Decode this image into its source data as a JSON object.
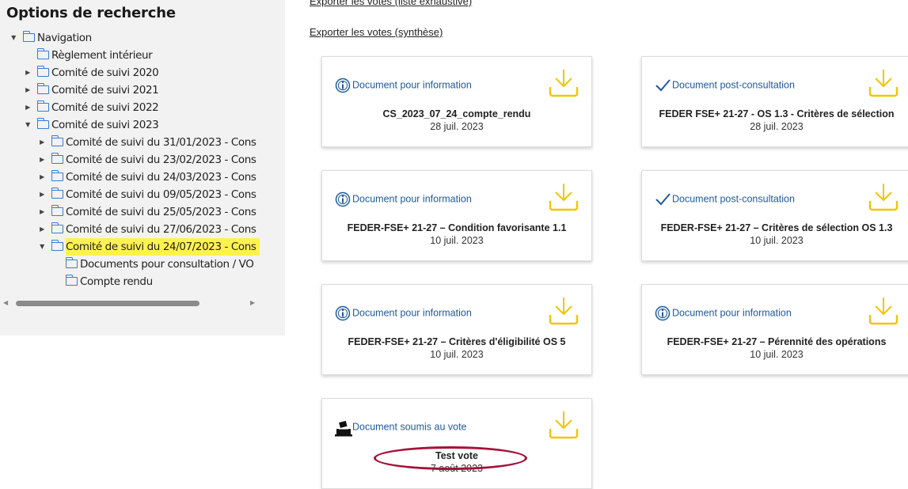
{
  "sidebar": {
    "title": "Options de recherche",
    "tree": [
      {
        "label": "Navigation",
        "toggle": "▼"
      },
      {
        "label": "Règlement intérieur",
        "toggle": ""
      },
      {
        "label": "Comité de suivi 2020",
        "toggle": "▶"
      },
      {
        "label": "Comité de suivi 2021",
        "toggle": "▶"
      },
      {
        "label": "Comité de suivi 2022",
        "toggle": "▶"
      },
      {
        "label": "Comité de suivi 2023",
        "toggle": "▼"
      },
      {
        "label": "Comité de suivi du 31/01/2023 - Cons",
        "toggle": "▶"
      },
      {
        "label": "Comité de suivi du 23/02/2023 - Cons",
        "toggle": "▶"
      },
      {
        "label": "Comité de suivi du 24/03/2023 - Cons",
        "toggle": "▶"
      },
      {
        "label": "Comité de suivi du 09/05/2023 - Cons",
        "toggle": "▶"
      },
      {
        "label": "Comité de suivi du 25/05/2023 - Cons",
        "toggle": "▶"
      },
      {
        "label": "Comité de suivi du 27/06/2023 - Cons",
        "toggle": "▶"
      },
      {
        "label": "Comité de suivi du 24/07/2023 - Cons",
        "toggle": "▼",
        "selected": true
      },
      {
        "label": "Documents pour consultation / VO",
        "toggle": ""
      },
      {
        "label": "Compte rendu",
        "toggle": ""
      }
    ],
    "scroll_left": "◀",
    "scroll_right": "▶"
  },
  "main": {
    "export_exhaustive": "Exporter les votes (liste exhaustive)",
    "export_synthese": "Exporter les votes (synthèse)",
    "cards": [
      {
        "type": "Document pour information",
        "icon": "info-icon",
        "title": "CS_2023_07_24_compte_rendu",
        "date": "28 juil. 2023"
      },
      {
        "type": "Document post-consultation",
        "icon": "check-icon",
        "title": "FEDER FSE+ 21-27 - OS 1.3 - Critères de sélection",
        "date": "28 juil. 2023"
      },
      {
        "type": "Document pour information",
        "icon": "info-icon",
        "title": "FEDER-FSE+ 21-27 – Condition favorisante 1.1",
        "date": "10 juil. 2023"
      },
      {
        "type": "Document post-consultation",
        "icon": "check-icon",
        "title": "FEDER-FSE+ 21-27 – Critères de sélection OS 1.3",
        "date": "10 juil. 2023"
      },
      {
        "type": "Document pour information",
        "icon": "info-icon",
        "title": "FEDER-FSE+ 21-27 – Critères d'éligibilité OS 5",
        "date": "10 juil. 2023"
      },
      {
        "type": "Document pour information",
        "icon": "info-icon",
        "title": "FEDER-FSE+ 21-27 – Pérennité des opérations",
        "date": "10 juil. 2023"
      },
      {
        "type": "Document soumis au vote",
        "icon": "ballot-box-icon",
        "title": "Test vote",
        "date": "7 août 2023"
      }
    ]
  },
  "colors": {
    "accent_blue": "#1f5aa0",
    "download_yellow": "#f2c500",
    "selection_highlight": "#fff24f",
    "annotation_red": "#a3123a"
  }
}
